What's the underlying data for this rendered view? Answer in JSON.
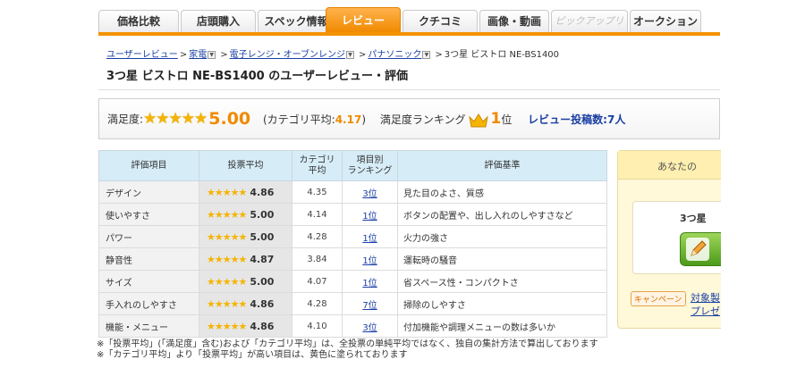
{
  "tabs": [
    {
      "label": "価格比較",
      "state": "normal"
    },
    {
      "label": "店頭購入",
      "state": "normal"
    },
    {
      "label": "スペック情報",
      "state": "normal"
    },
    {
      "label": "レビュー",
      "state": "active"
    },
    {
      "label": "クチコミ",
      "state": "normal"
    },
    {
      "label": "画像・動画",
      "state": "normal"
    },
    {
      "label": "ピックアップリスト",
      "state": "disabled"
    },
    {
      "label": "オークション",
      "state": "normal"
    }
  ],
  "breadcrumb": {
    "items": [
      "ユーザーレビュー",
      "家電",
      "電子レンジ・オーブンレンジ",
      "パナソニック"
    ],
    "current": "3つ星 ビストロ NE-BS1400",
    "separator": ">"
  },
  "page_title": "3つ星 ビストロ NE-BS1400 のユーザーレビュー・評価",
  "summary": {
    "satisfaction_label": "満足度:",
    "satisfaction_stars": "★★★★★",
    "satisfaction_score": "5.00",
    "category_avg_prefix": "(カテゴリ平均:",
    "category_avg_value": "4.17",
    "category_avg_suffix": ")",
    "ranking_label": "満足度ランキング",
    "ranking_value": "1",
    "ranking_unit": "位",
    "review_count": "レビュー投稿数:7人"
  },
  "table": {
    "headers": {
      "item": "評価項目",
      "vote_avg": "投票平均",
      "cat_avg": "カテゴリ\n平均",
      "rank": "項目別\nランキング",
      "criteria": "評価基準"
    },
    "rows": [
      {
        "item": "デザイン",
        "stars": "★★★★★",
        "score": "4.86",
        "cat_avg": "4.35",
        "rank": "3位",
        "criteria": "見た目のよさ、質感"
      },
      {
        "item": "使いやすさ",
        "stars": "★★★★★",
        "score": "5.00",
        "cat_avg": "4.14",
        "rank": "1位",
        "criteria": "ボタンの配置や、出し入れのしやすさなど"
      },
      {
        "item": "パワー",
        "stars": "★★★★★",
        "score": "5.00",
        "cat_avg": "4.28",
        "rank": "1位",
        "criteria": "火力の強さ"
      },
      {
        "item": "静音性",
        "stars": "★★★★★",
        "score": "4.87",
        "cat_avg": "3.84",
        "rank": "1位",
        "criteria": "運転時の騒音"
      },
      {
        "item": "サイズ",
        "stars": "★★★★★",
        "score": "5.00",
        "cat_avg": "4.07",
        "rank": "1位",
        "criteria": "省スペース性・コンパクトさ"
      },
      {
        "item": "手入れのしやすさ",
        "stars": "★★★★★",
        "score": "4.86",
        "cat_avg": "4.28",
        "rank": "7位",
        "criteria": "掃除のしやすさ"
      },
      {
        "item": "機能・メニュー",
        "stars": "★★★★★",
        "score": "4.86",
        "cat_avg": "4.10",
        "rank": "3位",
        "criteria": "付加機能や調理メニューの数は多いか"
      }
    ]
  },
  "notes": [
    "※「投票平均」(「満足度」含む)および「カテゴリ平均」は、全投票の単純平均ではなく、独自の集計方法で算出しております",
    "※「カテゴリ平均」より「投票平均」が高い項目は、黄色に塗られております"
  ],
  "side_panel": {
    "heading": "あなたの",
    "product": "3つ星",
    "write_icon": "pencil-icon",
    "campaign_badge": "キャンペーン",
    "campaign_link_1": "対象製",
    "campaign_link_2": "プレゼ"
  },
  "colors": {
    "accent": "#f39200",
    "link": "#1a3fa3",
    "star": "#f5b400",
    "table_header": "#d6ecf7"
  }
}
